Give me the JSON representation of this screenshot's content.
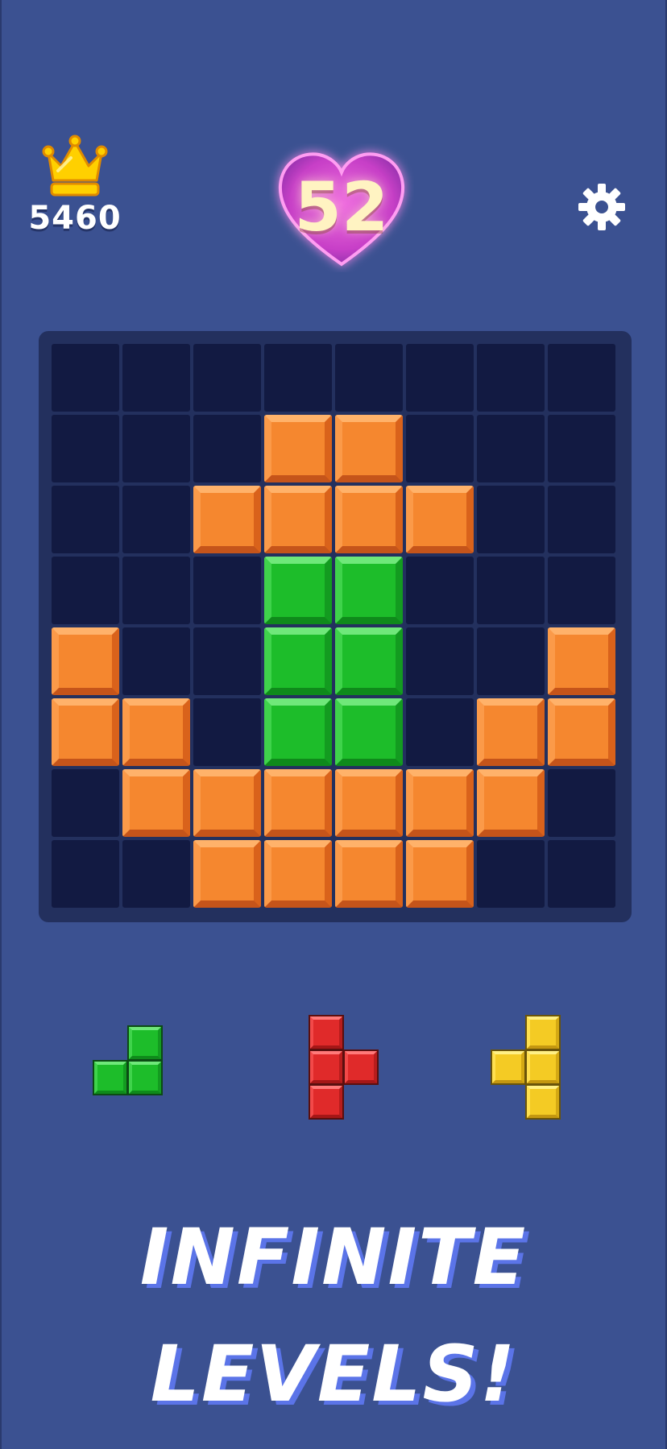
{
  "hud": {
    "best_score": "5460",
    "best_icon": "crown-icon",
    "current_score": "52",
    "score_badge_icon": "heart-icon",
    "settings_icon": "gear-icon"
  },
  "board": {
    "rows": 8,
    "cols": 8,
    "filled": [
      [
        1,
        3,
        "orange"
      ],
      [
        1,
        4,
        "orange"
      ],
      [
        2,
        2,
        "orange"
      ],
      [
        2,
        3,
        "orange"
      ],
      [
        2,
        4,
        "orange"
      ],
      [
        2,
        5,
        "orange"
      ],
      [
        3,
        3,
        "green"
      ],
      [
        3,
        4,
        "green"
      ],
      [
        4,
        0,
        "orange"
      ],
      [
        4,
        3,
        "green"
      ],
      [
        4,
        4,
        "green"
      ],
      [
        4,
        7,
        "orange"
      ],
      [
        5,
        0,
        "orange"
      ],
      [
        5,
        1,
        "orange"
      ],
      [
        5,
        3,
        "green"
      ],
      [
        5,
        4,
        "green"
      ],
      [
        5,
        6,
        "orange"
      ],
      [
        5,
        7,
        "orange"
      ],
      [
        6,
        1,
        "orange"
      ],
      [
        6,
        2,
        "orange"
      ],
      [
        6,
        3,
        "orange"
      ],
      [
        6,
        4,
        "orange"
      ],
      [
        6,
        5,
        "orange"
      ],
      [
        6,
        6,
        "orange"
      ],
      [
        7,
        2,
        "orange"
      ],
      [
        7,
        3,
        "orange"
      ],
      [
        7,
        4,
        "orange"
      ],
      [
        7,
        5,
        "orange"
      ]
    ]
  },
  "tray": {
    "pieces": [
      {
        "name": "green-piece",
        "color": "green",
        "cells": [
          [
            0,
            1
          ],
          [
            1,
            0
          ],
          [
            1,
            1
          ]
        ]
      },
      {
        "name": "red-piece",
        "color": "red",
        "cells": [
          [
            0,
            0
          ],
          [
            1,
            0
          ],
          [
            1,
            1
          ],
          [
            2,
            0
          ]
        ]
      },
      {
        "name": "yellow-piece",
        "color": "yellow",
        "cells": [
          [
            0,
            1
          ],
          [
            1,
            0
          ],
          [
            1,
            1
          ],
          [
            2,
            1
          ]
        ]
      }
    ]
  },
  "colors": {
    "background": "#3b5191",
    "board": "#23305e",
    "empty_cell": "#121a42",
    "orange": "#f5872f",
    "green": "#1dbd2a",
    "red": "#e02a2a",
    "yellow": "#f4cb24",
    "tagline_shadow": "#5b74e8"
  },
  "tagline": {
    "line1": "INFINITE",
    "line2": "LEVELS!"
  }
}
